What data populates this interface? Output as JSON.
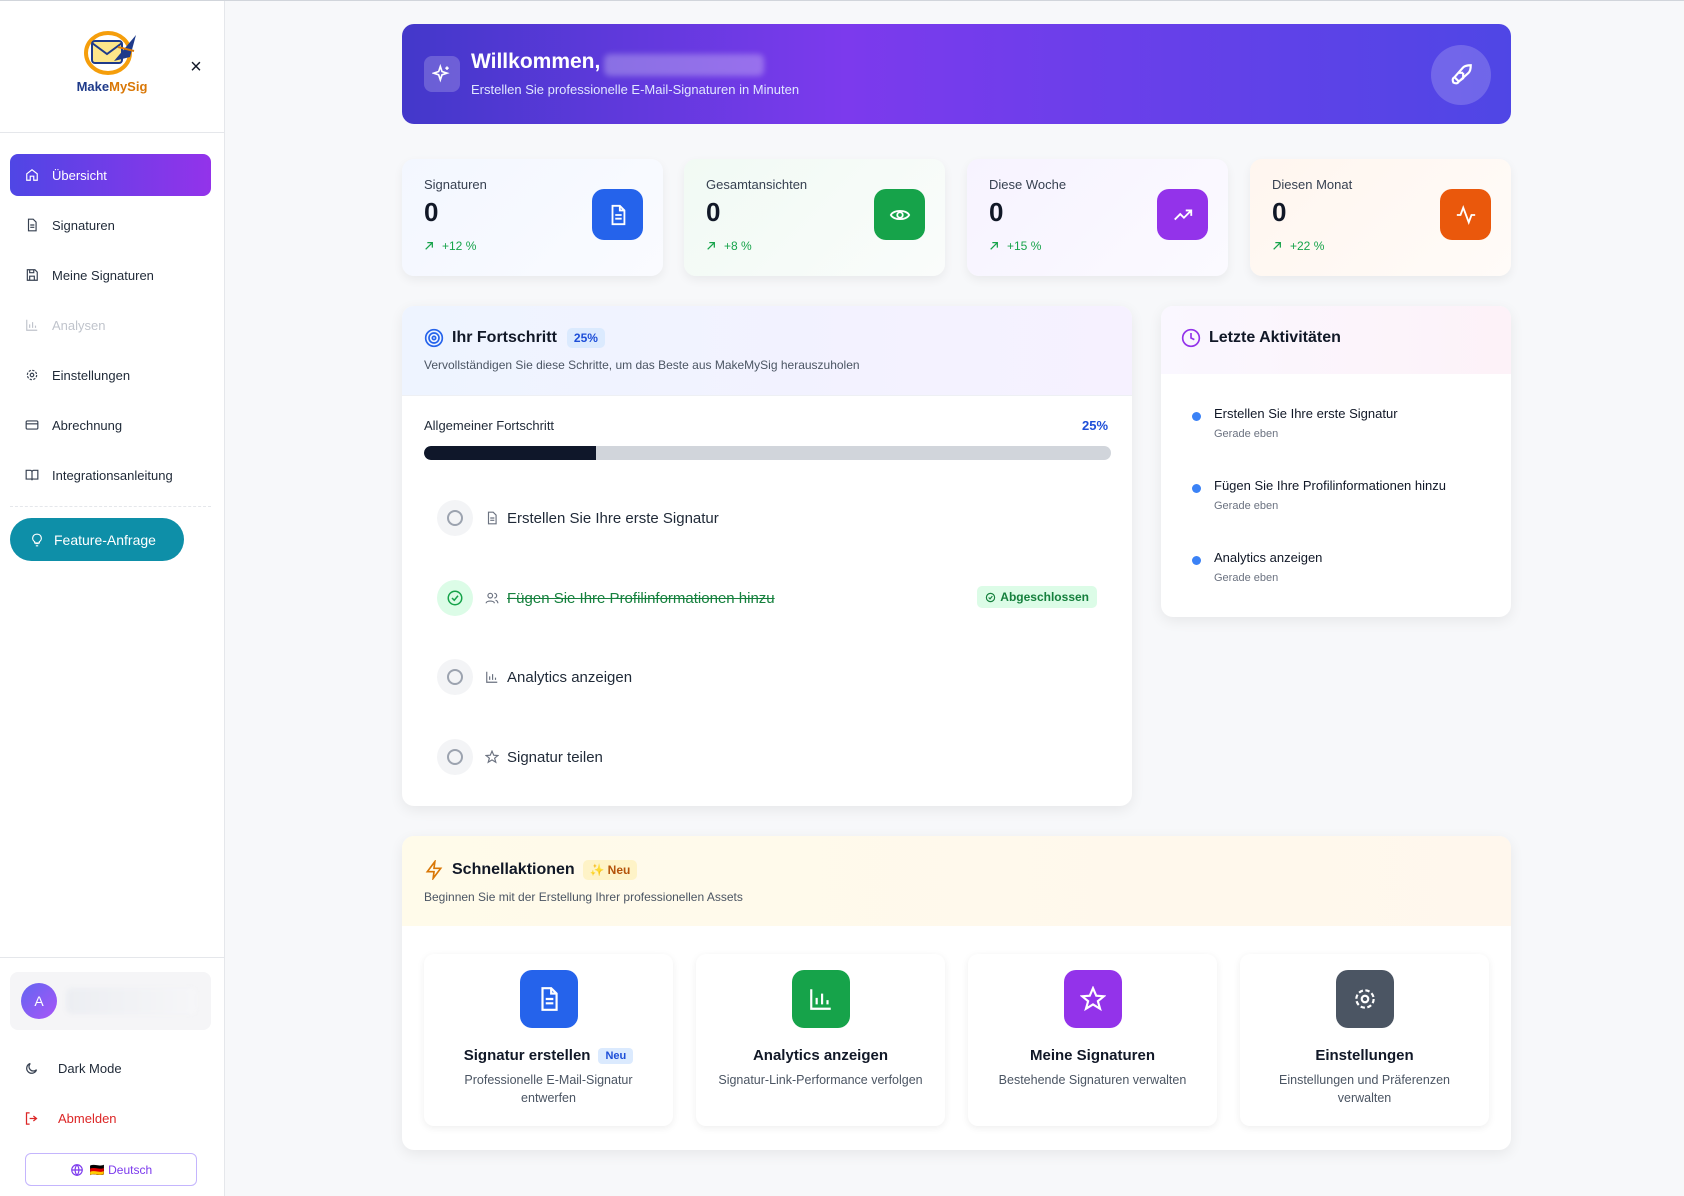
{
  "brand": {
    "name_part1": "Make",
    "name_part2": "MySig"
  },
  "sidebar": {
    "items": [
      {
        "label": "Übersicht",
        "icon": "home-icon",
        "active": true
      },
      {
        "label": "Signaturen",
        "icon": "file-icon"
      },
      {
        "label": "Meine Signaturen",
        "icon": "save-icon"
      },
      {
        "label": "Analysen",
        "icon": "bar-chart-icon",
        "disabled": true
      },
      {
        "label": "Einstellungen",
        "icon": "gear-icon"
      },
      {
        "label": "Abrechnung",
        "icon": "credit-card-icon"
      },
      {
        "label": "Integrationsanleitung",
        "icon": "book-icon"
      }
    ],
    "feature_button": "Feature-Anfrage",
    "user_initial": "A",
    "dark_mode": "Dark Mode",
    "logout": "Abmelden",
    "language": "🇩🇪 Deutsch"
  },
  "hero": {
    "title": "Willkommen,",
    "subtitle": "Erstellen Sie professionelle E-Mail-Signaturen in Minuten"
  },
  "stats": [
    {
      "label": "Signaturen",
      "value": "0",
      "change": "+12 %",
      "icon": "document-icon",
      "color": "#2563eb"
    },
    {
      "label": "Gesamtansichten",
      "value": "0",
      "change": "+8 %",
      "icon": "eye-icon",
      "color": "#16a34a"
    },
    {
      "label": "Diese Woche",
      "value": "0",
      "change": "+15 %",
      "icon": "trending-up-icon",
      "color": "#9333ea"
    },
    {
      "label": "Diesen Monat",
      "value": "0",
      "change": "+22 %",
      "icon": "activity-icon",
      "color": "#ea580c"
    }
  ],
  "progress": {
    "title": "Ihr Fortschritt",
    "badge": "25%",
    "subtitle": "Vervollständigen Sie diese Schritte, um das Beste aus MakeMySig herauszuholen",
    "overall_label": "Allgemeiner Fortschritt",
    "overall_pct": "25%",
    "fraction": 0.25,
    "steps": [
      {
        "label": "Erstellen Sie Ihre erste Signatur",
        "icon": "file-icon",
        "done": false
      },
      {
        "label": "Fügen Sie Ihre Profilinformationen hinzu",
        "icon": "users-icon",
        "done": true
      },
      {
        "label": "Analytics anzeigen",
        "icon": "bar-chart-icon",
        "done": false
      },
      {
        "label": "Signatur teilen",
        "icon": "star-icon",
        "done": false
      }
    ],
    "done_label": "Abgeschlossen"
  },
  "activity": {
    "title": "Letzte Aktivitäten",
    "items": [
      {
        "title": "Erstellen Sie Ihre erste Signatur",
        "time": "Gerade eben"
      },
      {
        "title": "Fügen Sie Ihre Profilinformationen hinzu",
        "time": "Gerade eben"
      },
      {
        "title": "Analytics anzeigen",
        "time": "Gerade eben"
      }
    ]
  },
  "quick": {
    "title": "Schnellaktionen",
    "badge": "Neu",
    "subtitle": "Beginnen Sie mit der Erstellung Ihrer professionellen Assets",
    "cards": [
      {
        "title": "Signatur erstellen",
        "badge": "Neu",
        "desc": "Professionelle E-Mail-Signatur entwerfen",
        "icon": "document-icon",
        "color": "#2563eb"
      },
      {
        "title": "Analytics anzeigen",
        "desc": "Signatur-Link-Performance verfolgen",
        "icon": "bar-chart-icon",
        "color": "#16a34a"
      },
      {
        "title": "Meine Signaturen",
        "desc": "Bestehende Signaturen verwalten",
        "icon": "star-icon",
        "color": "#9333ea"
      },
      {
        "title": "Einstellungen",
        "desc": "Einstellungen und Präferenzen verwalten",
        "icon": "gear-icon",
        "color": "#4b5563"
      }
    ]
  }
}
